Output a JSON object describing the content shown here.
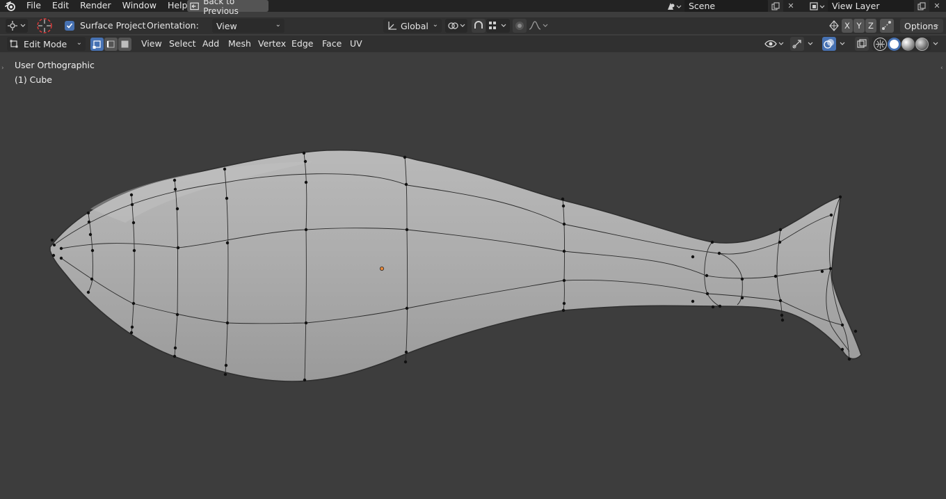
{
  "menubar": {
    "items": [
      "File",
      "Edit",
      "Render",
      "Window",
      "Help"
    ],
    "back_button": "Back to Previous",
    "scene": "Scene",
    "view_layer": "View Layer"
  },
  "tool_settings": {
    "surface_project_label": "Surface Project",
    "surface_project_checked": true,
    "orientation_label": "Orientation:",
    "orientation_value": "View",
    "transform_orientation": "Global",
    "axes": [
      "X",
      "Y",
      "Z"
    ],
    "options_label": "Options"
  },
  "header": {
    "mode": "Edit Mode",
    "menus": [
      "View",
      "Select",
      "Add",
      "Mesh",
      "Vertex",
      "Edge",
      "Face",
      "UV"
    ]
  },
  "viewport": {
    "view_name": "User Orthographic",
    "object_label": "(1) Cube"
  },
  "colors": {
    "accent": "#4772b3",
    "mesh_fill": "#a9a9a9",
    "vertex": "#111111",
    "origin": "#e8883a"
  },
  "icons": {
    "app_logo": "blender-logo-icon",
    "editor_type": "viewport-editor-icon",
    "snap": "magnet-icon",
    "proportional": "proportional-edit-icon",
    "visibility": "eye-icon",
    "overlays": "overlays-icon",
    "xray": "xray-icon",
    "shading": [
      "wireframe-shading-icon",
      "solid-shading-icon",
      "material-shading-icon",
      "rendered-shading-icon"
    ]
  }
}
